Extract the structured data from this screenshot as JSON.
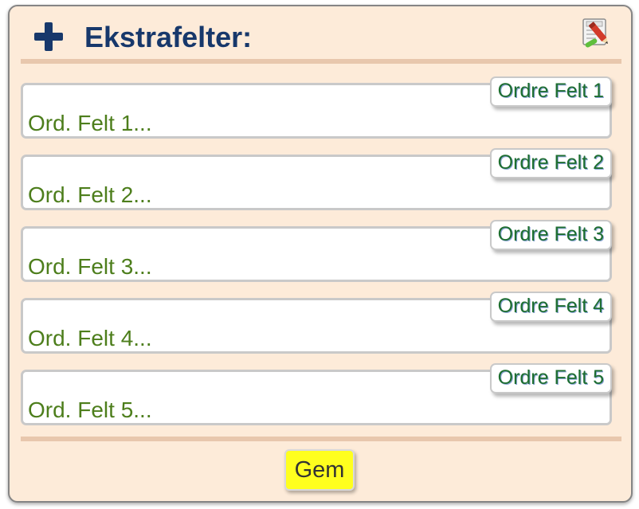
{
  "header": {
    "title": "Ekstrafelter:",
    "add_icon": "plus-icon",
    "edit_icon": "edit-document-icon"
  },
  "fields": [
    {
      "tag": "Ordre Felt 1",
      "placeholder": "Ord. Felt 1..."
    },
    {
      "tag": "Ordre Felt 2",
      "placeholder": "Ord. Felt 2..."
    },
    {
      "tag": "Ordre Felt 3",
      "placeholder": "Ord. Felt 3..."
    },
    {
      "tag": "Ordre Felt 4",
      "placeholder": "Ord. Felt 4..."
    },
    {
      "tag": "Ordre Felt 5",
      "placeholder": "Ord. Felt 5..."
    }
  ],
  "footer": {
    "save_label": "Gem"
  },
  "colors": {
    "panel_bg": "#fdebd9",
    "title": "#17386b",
    "field_text": "#4d7e1c",
    "tag_text": "#1d6e2f",
    "save_button_bg": "#ffff1e"
  }
}
